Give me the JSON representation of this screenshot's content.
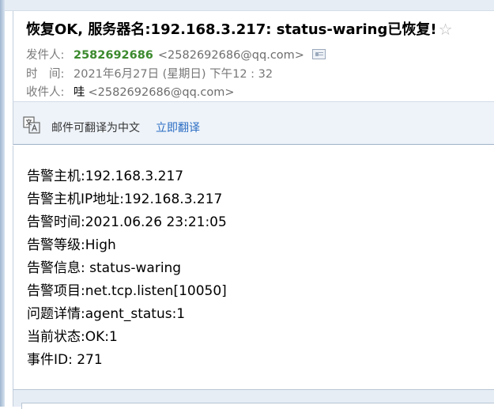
{
  "email": {
    "subject": "恢复OK, 服务器名:192.168.3.217: status-waring已恢复!",
    "star_icon": "star-icon",
    "from": {
      "label": "发件人:",
      "name": "2582692686",
      "address": "<2582692686@qq.com>",
      "contact_icon": "contact-card-icon"
    },
    "time": {
      "label": "时　间:",
      "value": "2021年6月27日 (星期日) 下午12 : 32"
    },
    "to": {
      "label": "收件人:",
      "name": "哇",
      "address": "<2582692686@qq.com>"
    }
  },
  "translate": {
    "icon": "translate-icon",
    "text": "邮件可翻译为中文",
    "link": "立即翻译"
  },
  "body_lines": [
    "告警主机:192.168.3.217",
    "告警主机IP地址:192.168.3.217",
    "告警时间:2021.06.26 23:21:05",
    "告警等级:High",
    "告警信息: status-waring",
    "告警项目:net.tcp.listen[10050]",
    "问题详情:agent_status:1",
    "当前状态:OK:1",
    "事件ID: 271"
  ],
  "colors": {
    "sender_green": "#3c8a2e",
    "link_blue": "#2a6cc3",
    "bar_background": "#eef3f9"
  }
}
